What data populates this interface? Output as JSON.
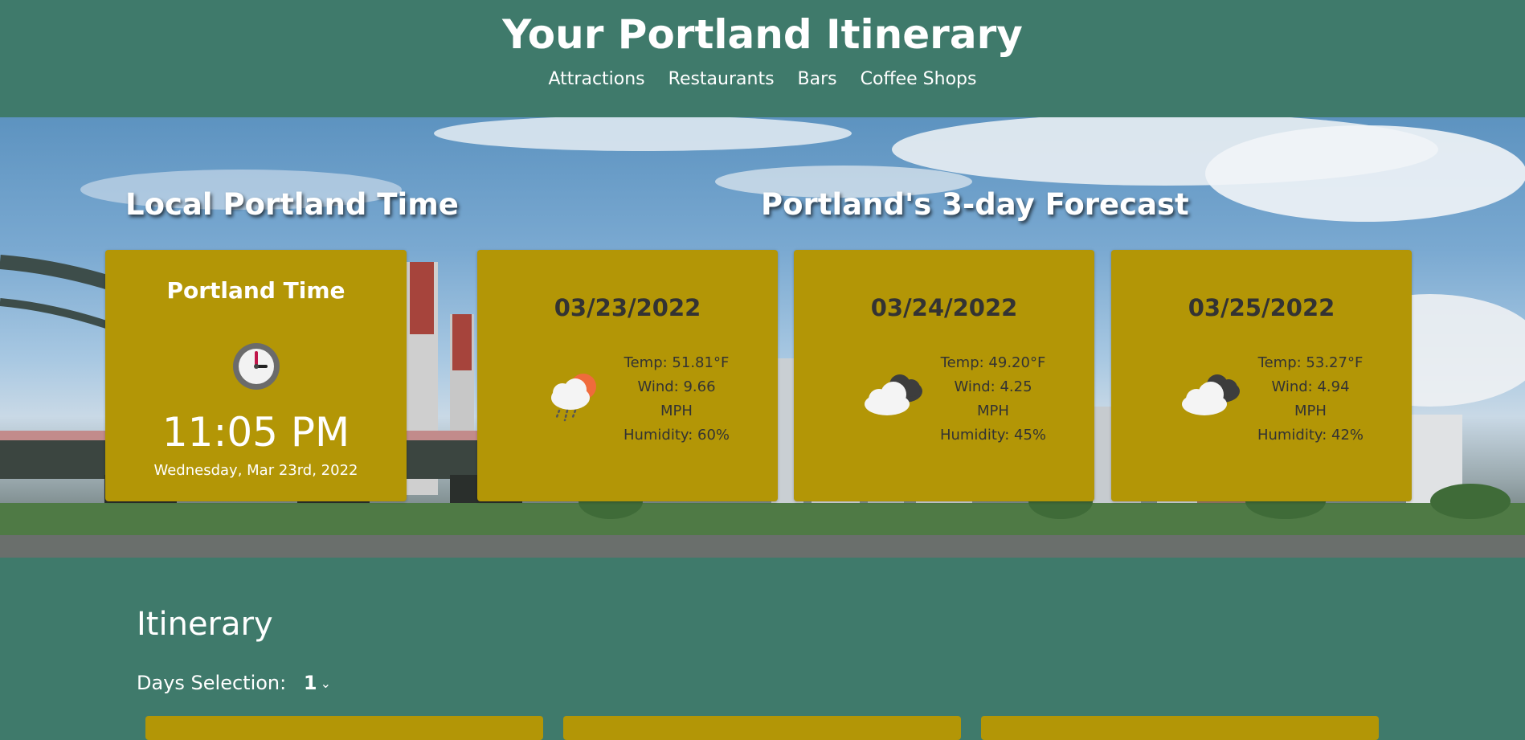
{
  "header": {
    "title": "Your Portland Itinerary",
    "nav": [
      "Attractions",
      "Restaurants",
      "Bars",
      "Coffee Shops"
    ]
  },
  "time_section": {
    "heading": "Local Portland Time",
    "card": {
      "title": "Portland Time",
      "icon": "clock-icon",
      "time": "11:05 PM",
      "date": "Wednesday, Mar 23rd, 2022"
    }
  },
  "forecast_section": {
    "heading": "Portland's 3-day Forecast",
    "days": [
      {
        "date": "03/23/2022",
        "icon": "rain-cloud-sun-icon",
        "temp": "Temp: 51.81°F",
        "wind": "Wind: 9.66",
        "wind_unit": "MPH",
        "humidity": "Humidity: 60%"
      },
      {
        "date": "03/24/2022",
        "icon": "cloudy-icon",
        "temp": "Temp: 49.20°F",
        "wind": "Wind: 4.25",
        "wind_unit": "MPH",
        "humidity": "Humidity: 45%"
      },
      {
        "date": "03/25/2022",
        "icon": "cloudy-icon",
        "temp": "Temp: 53.27°F",
        "wind": "Wind: 4.94",
        "wind_unit": "MPH",
        "humidity": "Humidity: 42%"
      }
    ]
  },
  "itinerary": {
    "heading": "Itinerary",
    "days_label": "Days Selection:",
    "days_value": "1"
  },
  "colors": {
    "page_bg": "#3f7a6b",
    "card_bg": "#b39606",
    "card_text_dark": "#333333"
  }
}
